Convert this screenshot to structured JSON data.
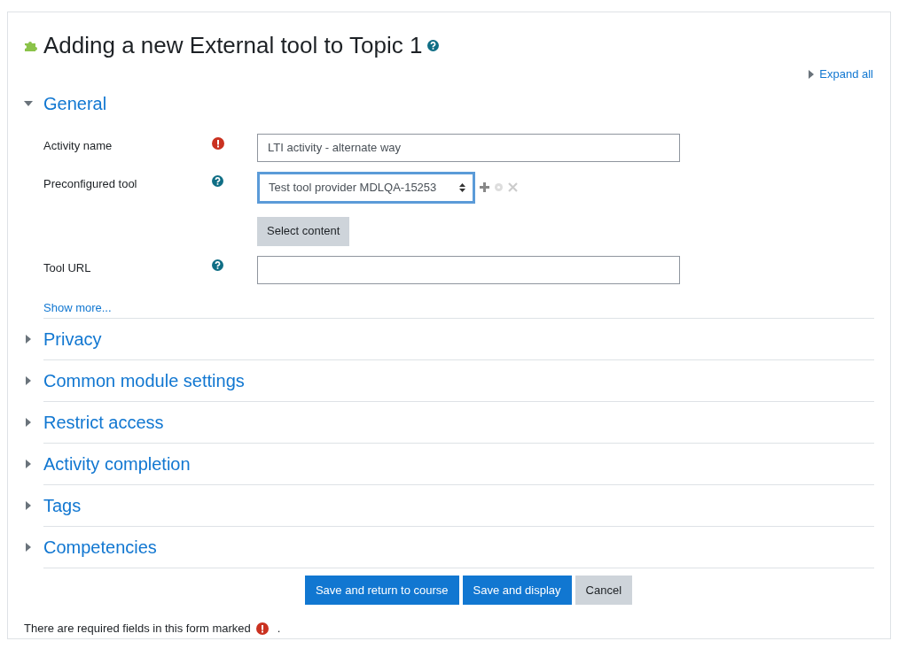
{
  "title": "Adding a new External tool to Topic 1",
  "expand_all": "Expand all",
  "sections": [
    {
      "title": "General",
      "expanded": true
    },
    {
      "title": "Privacy",
      "expanded": false
    },
    {
      "title": "Common module settings",
      "expanded": false
    },
    {
      "title": "Restrict access",
      "expanded": false
    },
    {
      "title": "Activity completion",
      "expanded": false
    },
    {
      "title": "Tags",
      "expanded": false
    },
    {
      "title": "Competencies",
      "expanded": false
    }
  ],
  "general_fields": [
    {
      "label": "Activity name",
      "kind": "text",
      "required": true,
      "value": "LTI activity - alternate way"
    },
    {
      "label": "Preconfigured tool",
      "kind": "select",
      "required": false,
      "value": "Test tool provider MDLQA-15253",
      "button": "Select content"
    },
    {
      "label": "Tool URL",
      "kind": "text",
      "required": false
    }
  ],
  "show_more": "Show more...",
  "buttons": [
    {
      "label": "Save and return to course",
      "kind": "primary"
    },
    {
      "label": "Save and display",
      "kind": "primary"
    },
    {
      "label": "Cancel",
      "kind": "secondary"
    }
  ],
  "footer": {
    "text": "There are required fields in this form marked",
    "end": "."
  }
}
